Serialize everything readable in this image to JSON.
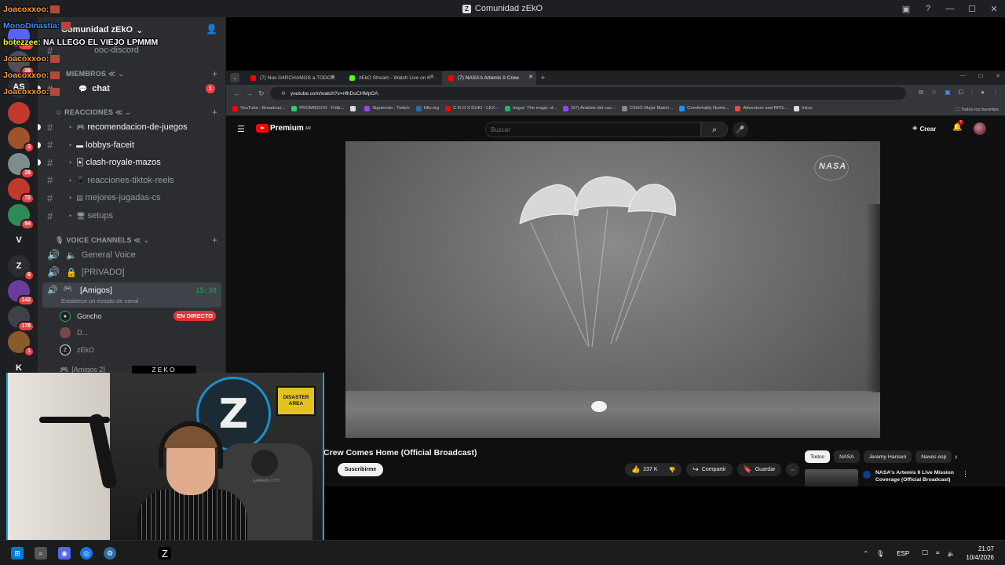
{
  "window": {
    "title": "Comunidad zEkO"
  },
  "server": {
    "name": "Comunidad zEkO",
    "rail": [
      {
        "badge": "498",
        "color": "#5865f2",
        "letter": ""
      },
      {
        "badge": "26",
        "color": "#4e5058",
        "letter": ""
      },
      {
        "badge": "",
        "color": "#2b2d31",
        "letter": "AS"
      },
      {
        "badge": "",
        "color": "#c0392b",
        "letter": ""
      },
      {
        "badge": "3",
        "color": "#a0522d",
        "letter": ""
      },
      {
        "badge": "26",
        "color": "#7f8c8d",
        "letter": ""
      },
      {
        "badge": "72",
        "color": "#c0392b",
        "letter": ""
      },
      {
        "badge": "94",
        "color": "#2e8b57",
        "letter": ""
      },
      {
        "badge": "",
        "color": "#1e1f22",
        "letter": "V"
      },
      {
        "badge": "6",
        "color": "#2b2d31",
        "letter": "Z"
      },
      {
        "badge": "142",
        "color": "#6a3d9a",
        "letter": ""
      },
      {
        "badge": "178",
        "color": "#404249",
        "letter": ""
      },
      {
        "badge": "1",
        "color": "#8b5a2b",
        "letter": ""
      },
      {
        "badge": "",
        "color": "#1e1f22",
        "letter": "K"
      }
    ]
  },
  "chat": [
    {
      "user": "Joacoxxoo:",
      "text": "",
      "color": "orange"
    },
    {
      "user": "MonoDinastía:",
      "text": "",
      "color": "blue"
    },
    {
      "user": "botezzee:",
      "text": "NA LLEGO EL VIEJO LPMMM",
      "color": "yellow"
    },
    {
      "user": "Joacoxxoo:",
      "text": "",
      "color": "orange"
    },
    {
      "user": "Joacoxxoo:",
      "text": "",
      "color": "orange"
    },
    {
      "user": "Joacoxxoo:",
      "text": "",
      "color": "orange"
    }
  ],
  "channels": {
    "top": {
      "name": "ooc-discord"
    },
    "cat_members": "MIEMBROS",
    "chat_channel": {
      "name": "chat",
      "unread": "1"
    },
    "cat_reactions": "REACCIONES",
    "text_channels": [
      "recomendacion-de-juegos",
      "lobbys-faceit",
      "clash-royale-mazos",
      "reacciones-tiktok-reels",
      "mejores-jugadas-cs",
      "setups"
    ],
    "cat_voice": "VOICE CHANNELS",
    "voice_channels": [
      "General Voice",
      "[PRIVADO]"
    ],
    "active_voice": {
      "name": "[Amigos]",
      "time": "15:30",
      "status": "Establece un estado de canal"
    },
    "voice_users": [
      "Goncho",
      "D...",
      "zEkO"
    ],
    "live_label": "EN DIRECTO",
    "next_voice": "[Amigos 2]"
  },
  "browser": {
    "tabs": [
      {
        "label": "(7) Nos G4RCHAMOS a TODOS",
        "color": "#ff0000"
      },
      {
        "label": "zEkO Stream - Watch Live on K",
        "color": "#53fc18"
      },
      {
        "label": "(7) NASA's Artemis II Crew",
        "color": "#ff0000"
      }
    ],
    "url": "youtube.com/watch?v=nfhDuCHMpGA",
    "bookmarks": [
      {
        "label": "YouTube - Broadcas...",
        "color": "#ff0000"
      },
      {
        "label": "PROMIEDOS - Fútb...",
        "color": "#2ecc71"
      },
      {
        "label": "",
        "color": "#dddddd"
      },
      {
        "label": "Siguiendo - Twitch",
        "color": "#9146ff"
      },
      {
        "label": "Hltv.org",
        "color": "#2b6ea6"
      },
      {
        "label": "C.R.O X DUKI - LEX...",
        "color": "#ff0000"
      },
      {
        "label": "Imgur: The magic of...",
        "color": "#1bb76e"
      },
      {
        "label": "(57) Análisis del cas...",
        "color": "#9146ff"
      },
      {
        "label": "CSGO Major Match...",
        "color": "#888888"
      },
      {
        "label": "Comfortably Numb...",
        "color": "#1e90ff"
      },
      {
        "label": "Adventure and RPG...",
        "color": "#e74c3c"
      },
      {
        "label": "Inicio",
        "color": "#dddddd"
      }
    ],
    "bookmarks_all": "Todos los favoritos"
  },
  "youtube": {
    "logo": "Premium",
    "logo_region": "AR",
    "search_placeholder": "Buscar",
    "create": "Crear",
    "notif_count": "7",
    "video_watermark": "NASA",
    "title": "Crew Comes Home (Official Broadcast)",
    "subscribe": "Suscribirme",
    "likes": "237 K",
    "share": "Compartir",
    "save": "Guardar",
    "chips": [
      "Todos",
      "NASA",
      "Jeremy Hansen",
      "Naves esp"
    ],
    "rec_title": "NASA's Artemis II Live Mission Coverage (Official Broadcast)"
  },
  "cam": {
    "label": "ZEKO",
    "sign": "DISASTER AREA",
    "chair_text": "GAMERS CITY"
  },
  "taskbar": {
    "lang": "ESP",
    "time": "21:07",
    "date": "10/4/2026"
  }
}
